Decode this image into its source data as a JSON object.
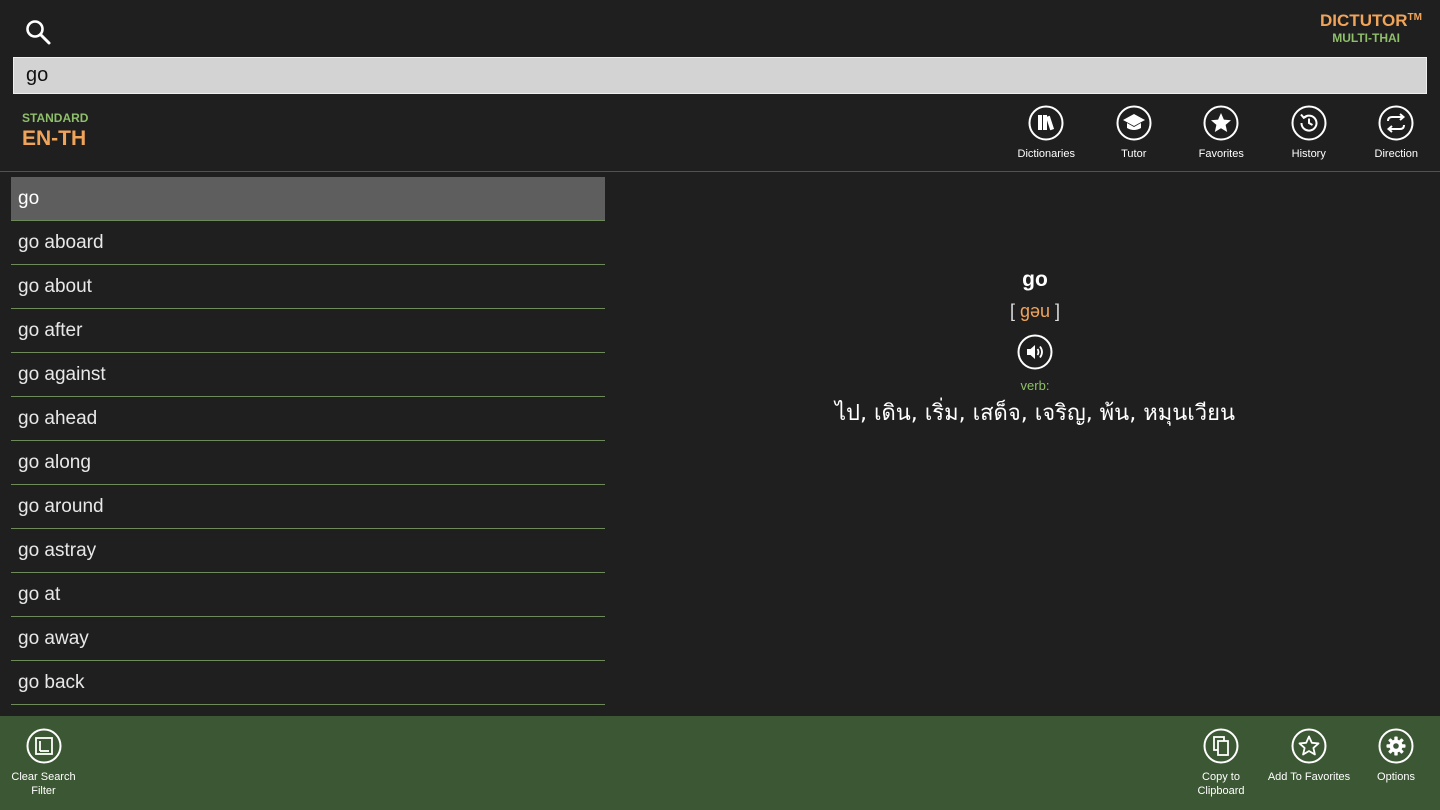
{
  "brand": {
    "name": "DICTUTOR",
    "tm": "TM",
    "sub": "MULTI-THAI"
  },
  "search": {
    "value": "go",
    "placeholder": ""
  },
  "dictionary": {
    "type": "STANDARD",
    "pair": "EN-TH"
  },
  "toolbar": {
    "dictionaries": "Dictionaries",
    "tutor": "Tutor",
    "favorites": "Favorites",
    "history": "History",
    "direction": "Direction"
  },
  "words": [
    "go",
    "go aboard",
    "go about",
    "go after",
    "go against",
    "go ahead",
    "go along",
    "go around",
    "go astray",
    "go at",
    "go away",
    "go back"
  ],
  "selected_index": 0,
  "definition": {
    "word": "go",
    "phonetic_open": "[ ",
    "phonetic": "gəu",
    "phonetic_close": " ]",
    "pos": "verb:",
    "translation": "ไป, เดิน, เริ่ม, เสด็จ, เจริญ, พ้น, หมุนเวียน"
  },
  "appbar": {
    "clear_filter": "Clear Search\nFilter",
    "copy": "Copy to\nClipboard",
    "add_favorites": "Add To Favorites",
    "options": "Options"
  },
  "colors": {
    "accent": "#f0a45a",
    "green": "#8fbf6a",
    "appbar": "#3c5733",
    "background": "#1f1f1f"
  }
}
